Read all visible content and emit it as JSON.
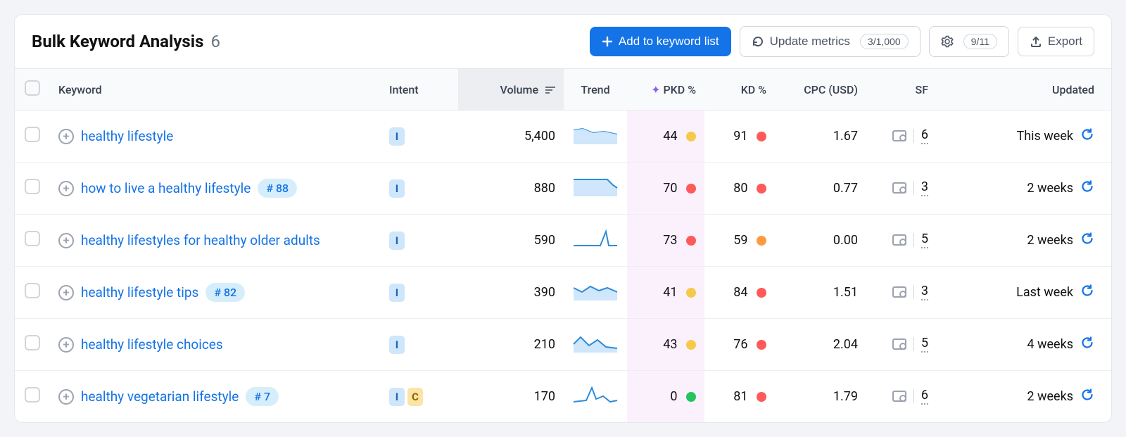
{
  "header": {
    "title": "Bulk Keyword Analysis",
    "count": "6",
    "add_button": "Add to keyword list",
    "update_button": "Update metrics",
    "update_count": "3/1,000",
    "columns_count": "9/11",
    "export_button": "Export"
  },
  "columns": {
    "keyword": "Keyword",
    "intent": "Intent",
    "volume": "Volume",
    "trend": "Trend",
    "pkd": "PKD %",
    "kd": "KD %",
    "cpc": "CPC (USD)",
    "sf": "SF",
    "updated": "Updated"
  },
  "rows": [
    {
      "keyword": "healthy lifestyle",
      "rank": null,
      "intents": [
        "I"
      ],
      "volume": "5,400",
      "trend": "line-high-flat",
      "pkd": "44",
      "pkd_dot": "yellow",
      "kd": "91",
      "kd_dot": "red",
      "cpc": "1.67",
      "sf": "6",
      "updated": "This week"
    },
    {
      "keyword": "how to live a healthy lifestyle",
      "rank": "# 88",
      "intents": [
        "I"
      ],
      "volume": "880",
      "trend": "area-drop",
      "pkd": "70",
      "pkd_dot": "red",
      "kd": "80",
      "kd_dot": "red",
      "cpc": "0.77",
      "sf": "3",
      "updated": "2 weeks"
    },
    {
      "keyword": "healthy lifestyles for healthy older adults",
      "rank": null,
      "intents": [
        "I"
      ],
      "volume": "590",
      "trend": "line-spike",
      "pkd": "73",
      "pkd_dot": "red",
      "kd": "59",
      "kd_dot": "orange",
      "cpc": "0.00",
      "sf": "5",
      "updated": "2 weeks"
    },
    {
      "keyword": "healthy lifestyle tips",
      "rank": "# 82",
      "intents": [
        "I"
      ],
      "volume": "390",
      "trend": "area-wavy",
      "pkd": "41",
      "pkd_dot": "yellow",
      "kd": "84",
      "kd_dot": "red",
      "cpc": "1.51",
      "sf": "3",
      "updated": "Last week"
    },
    {
      "keyword": "healthy lifestyle choices",
      "rank": null,
      "intents": [
        "I"
      ],
      "volume": "210",
      "trend": "area-up-down",
      "pkd": "43",
      "pkd_dot": "yellow",
      "kd": "76",
      "kd_dot": "red",
      "cpc": "2.04",
      "sf": "5",
      "updated": "4 weeks"
    },
    {
      "keyword": "healthy vegetarian lifestyle",
      "rank": "# 7",
      "intents": [
        "I",
        "C"
      ],
      "volume": "170",
      "trend": "line-peak",
      "pkd": "0",
      "pkd_dot": "green",
      "kd": "81",
      "kd_dot": "red",
      "cpc": "1.79",
      "sf": "6",
      "updated": "2 weeks"
    }
  ]
}
